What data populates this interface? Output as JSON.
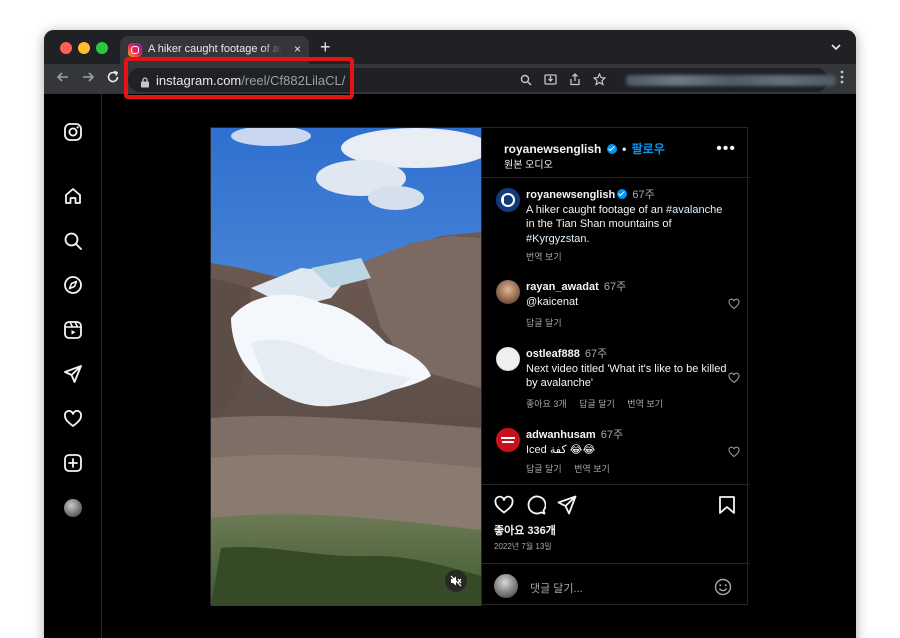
{
  "browser": {
    "tab_title": "A hiker caught footage of an #avalanche in the Tian Shan mountains of #Kyrgyzstan",
    "tab_close": "×",
    "new_tab": "+",
    "url_host": "instagram.com",
    "url_path": "/reel/Cf882LilaCL/"
  },
  "post": {
    "header": {
      "username": "royanewsenglish",
      "separator": "•",
      "follow": "팔로우",
      "audio": "원본 오디오",
      "more": "•••"
    },
    "caption": {
      "username": "royanewsenglish",
      "time": "67주",
      "text_part1": "A hiker caught footage of an ",
      "tag1": "#avalanche",
      "text_part2": " in the Tian Shan mountains of ",
      "tag2": "#Kyrgyzstan",
      "text_part3": ".",
      "translate": "번역 보기"
    },
    "comments": [
      {
        "username": "rayan_awadat",
        "time": "67주",
        "text": "@kaicenat",
        "reply": "답글 달기"
      },
      {
        "username": "ostleaf888",
        "time": "67주",
        "text": "Next video titled 'What it's like to be killed by avalanche'",
        "likes": "좋아요 3개",
        "reply": "답글 달기",
        "translate": "번역 보기"
      },
      {
        "username": "adwanhusam",
        "time": "67주",
        "text": "Iced كفة 😂😂",
        "reply": "답글 달기",
        "translate": "번역 보기"
      }
    ],
    "likes": "좋아요 336개",
    "date": "2022년 7월 13일",
    "add_comment_placeholder": "댓글 달기..."
  },
  "colors": {
    "accent": "#0095f6",
    "highlight_box": "#e01616",
    "background": "#000000"
  }
}
